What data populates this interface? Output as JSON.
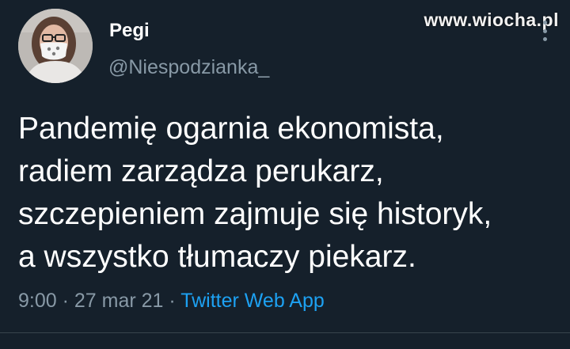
{
  "author": {
    "display_name": "Pegi",
    "handle": "@Niespodzianka_"
  },
  "watermark": "www.wiocha.pl",
  "tweet": {
    "lines": [
      "Pandemię ogarnia ekonomista,",
      "radiem zarządza perukarz,",
      "szczepieniem zajmuje się historyk,",
      "a wszystko tłumaczy piekarz."
    ],
    "time": "9:00",
    "separator_1": " · ",
    "date": "27 mar 21",
    "separator_2": " · ",
    "source": "Twitter Web App"
  },
  "colors": {
    "background": "#15202b",
    "secondary_text": "#8899a6",
    "link": "#1da1f2"
  },
  "icons": {
    "more": "more-vertical-icon"
  }
}
